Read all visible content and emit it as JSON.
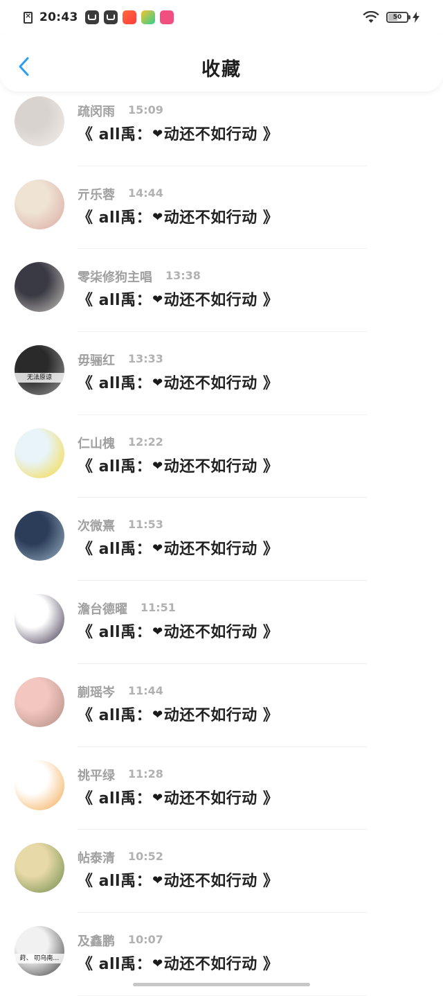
{
  "status_bar": {
    "time": "20:43",
    "battery": "50",
    "battery_level": 0.5
  },
  "header": {
    "title": "收藏",
    "back_icon": "chevron-left-icon",
    "accent_color": "#2a9df4"
  },
  "items": [
    {
      "name": "疏闵雨",
      "time": "15:09",
      "message_prefix": "《 all禹：",
      "heart": "❤",
      "message_suffix": "动还不如行动 》",
      "avatar_colors": [
        "#d9d3cf",
        "#f2eeea"
      ]
    },
    {
      "name": "亓乐蓉",
      "time": "14:44",
      "message_prefix": "《 all禹：",
      "heart": "❤",
      "message_suffix": "动还不如行动 》",
      "avatar_colors": [
        "#efe3d4",
        "#d9a9a0"
      ]
    },
    {
      "name": "零柒修狗主唱",
      "time": "13:38",
      "message_prefix": "《 all禹：",
      "heart": "❤",
      "message_suffix": "动还不如行动 》",
      "avatar_colors": [
        "#3a3a44",
        "#c9c3bd"
      ]
    },
    {
      "name": "毋骊红",
      "time": "13:33",
      "message_prefix": "《 all禹：",
      "heart": "❤",
      "message_suffix": "动还不如行动 》",
      "avatar_text": "无法原谅",
      "avatar_colors": [
        "#2a2a2a",
        "#9a9a9a"
      ]
    },
    {
      "name": "仁山槐",
      "time": "12:22",
      "message_prefix": "《 all禹：",
      "heart": "❤",
      "message_suffix": "动还不如行动 》",
      "avatar_colors": [
        "#e8f4f8",
        "#f6d83a"
      ]
    },
    {
      "name": "次微熹",
      "time": "11:53",
      "message_prefix": "《 all禹：",
      "heart": "❤",
      "message_suffix": "动还不如行动 》",
      "avatar_colors": [
        "#2c3d5a",
        "#9ab2c4"
      ]
    },
    {
      "name": "澹台德曜",
      "time": "11:51",
      "message_prefix": "《 all禹：",
      "heart": "❤",
      "message_suffix": "动还不如行动 》",
      "avatar_colors": [
        "#ffffff",
        "#3b2f4a"
      ]
    },
    {
      "name": "蒯瑶岑",
      "time": "11:44",
      "message_prefix": "《 all禹：",
      "heart": "❤",
      "message_suffix": "动还不如行动 》",
      "avatar_colors": [
        "#f3c7c0",
        "#b08a80"
      ]
    },
    {
      "name": "祧平绿",
      "time": "11:28",
      "message_prefix": "《 all禹：",
      "heart": "❤",
      "message_suffix": "动还不如行动 》",
      "avatar_colors": [
        "#ffffff",
        "#f3a64a"
      ]
    },
    {
      "name": "帖泰清",
      "time": "10:52",
      "message_prefix": "《 all禹：",
      "heart": "❤",
      "message_suffix": "动还不如行动 》",
      "avatar_colors": [
        "#e8d9a8",
        "#6a8a4a"
      ]
    },
    {
      "name": "及鑫鹏",
      "time": "10:07",
      "message_prefix": "《 all禹：",
      "heart": "❤",
      "message_suffix": "动还不如行动 》",
      "avatar_text": "莳、 叨乌南…",
      "avatar_colors": [
        "#f1f1f1",
        "#3a3a3a"
      ]
    }
  ]
}
